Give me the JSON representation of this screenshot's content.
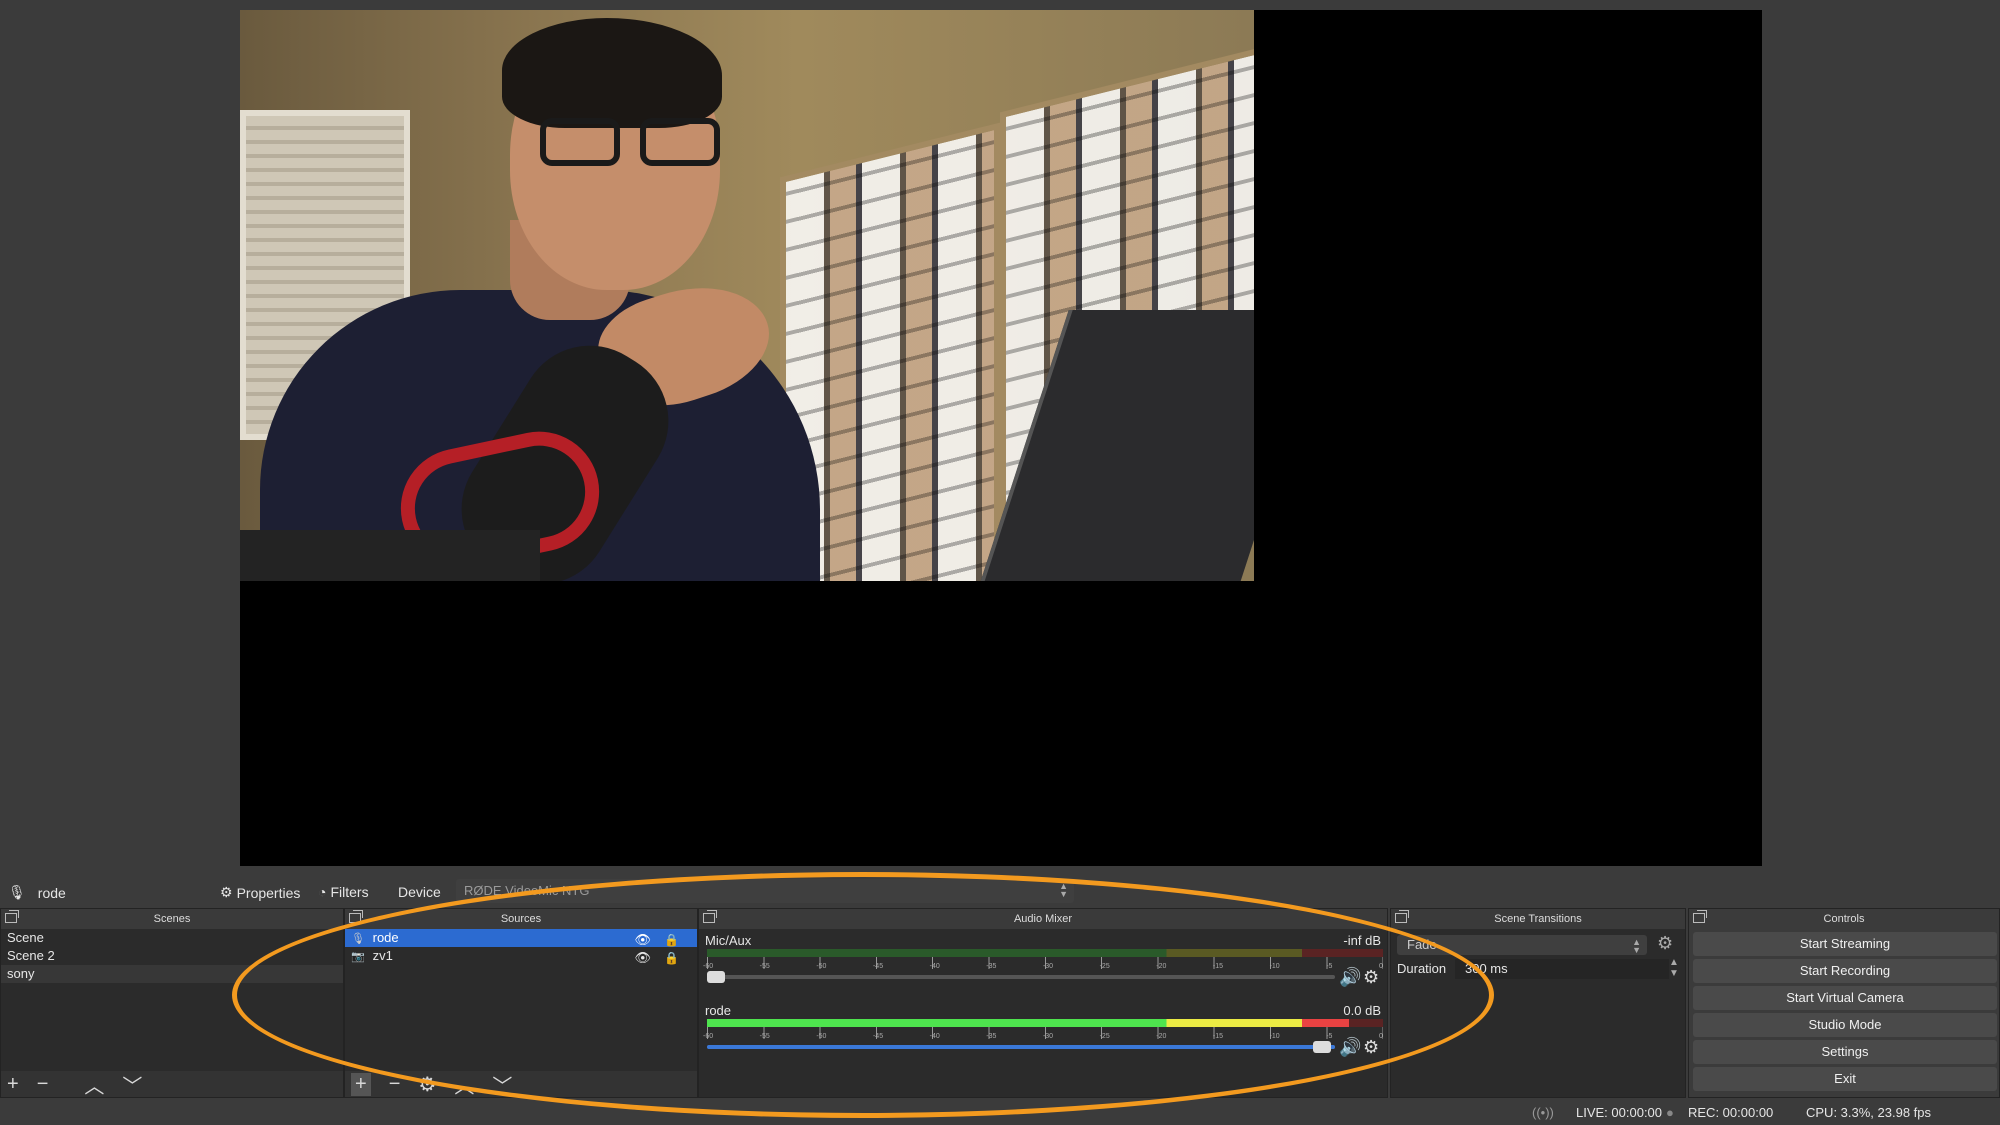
{
  "source_toolbar": {
    "source_name": "rode",
    "properties_label": "Properties",
    "filters_label": "Filters",
    "device_label": "Device",
    "device_value": "RØDE VideoMic NTG"
  },
  "scenes": {
    "title": "Scenes",
    "items": [
      {
        "label": "Scene"
      },
      {
        "label": "Scene 2"
      },
      {
        "label": "sony"
      }
    ]
  },
  "sources": {
    "title": "Sources",
    "items": [
      {
        "label": "rode",
        "icon": "microphone-icon",
        "selected": true
      },
      {
        "label": "zv1",
        "icon": "camera-icon",
        "selected": false
      }
    ]
  },
  "mixer": {
    "title": "Audio Mixer",
    "tick_labels": [
      "-60",
      "-55",
      "-50",
      "-45",
      "-40",
      "-35",
      "-30",
      "-25",
      "-20",
      "-15",
      "-10",
      "-5",
      "0"
    ],
    "channels": [
      {
        "name": "Mic/Aux",
        "db": "-inf dB",
        "level": 0.0,
        "volume": 0.0
      },
      {
        "name": "rode",
        "db": "0.0 dB",
        "level": 0.95,
        "volume": 1.0
      }
    ]
  },
  "transitions": {
    "title": "Scene Transitions",
    "selected": "Fade",
    "duration_label": "Duration",
    "duration_value": "300 ms"
  },
  "controls": {
    "title": "Controls",
    "buttons": [
      "Start Streaming",
      "Start Recording",
      "Start Virtual Camera",
      "Studio Mode",
      "Settings",
      "Exit"
    ]
  },
  "status": {
    "live": "LIVE: 00:00:00",
    "rec": "REC: 00:00:00",
    "cpu": "CPU: 3.3%, 23.98 fps"
  },
  "colors": {
    "annotation": "#f39a1f",
    "selection": "#2c6bd1"
  }
}
